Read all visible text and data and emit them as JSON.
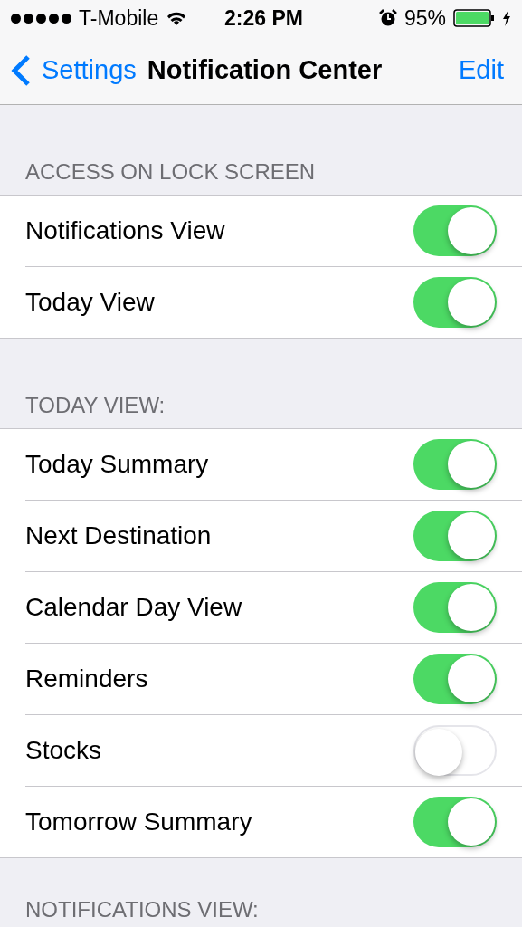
{
  "status_bar": {
    "carrier": "T-Mobile",
    "time": "2:26 PM",
    "battery": "95%"
  },
  "nav": {
    "back": "Settings",
    "title": "Notification Center",
    "action": "Edit"
  },
  "sections": [
    {
      "header": "ACCESS ON LOCK SCREEN",
      "rows": [
        {
          "label": "Notifications View",
          "on": true
        },
        {
          "label": "Today View",
          "on": true
        }
      ]
    },
    {
      "header": "TODAY VIEW:",
      "rows": [
        {
          "label": "Today Summary",
          "on": true
        },
        {
          "label": "Next Destination",
          "on": true
        },
        {
          "label": "Calendar Day View",
          "on": true
        },
        {
          "label": "Reminders",
          "on": true
        },
        {
          "label": "Stocks",
          "on": false
        },
        {
          "label": "Tomorrow Summary",
          "on": true
        }
      ]
    },
    {
      "header": "NOTIFICATIONS VIEW:"
    }
  ]
}
